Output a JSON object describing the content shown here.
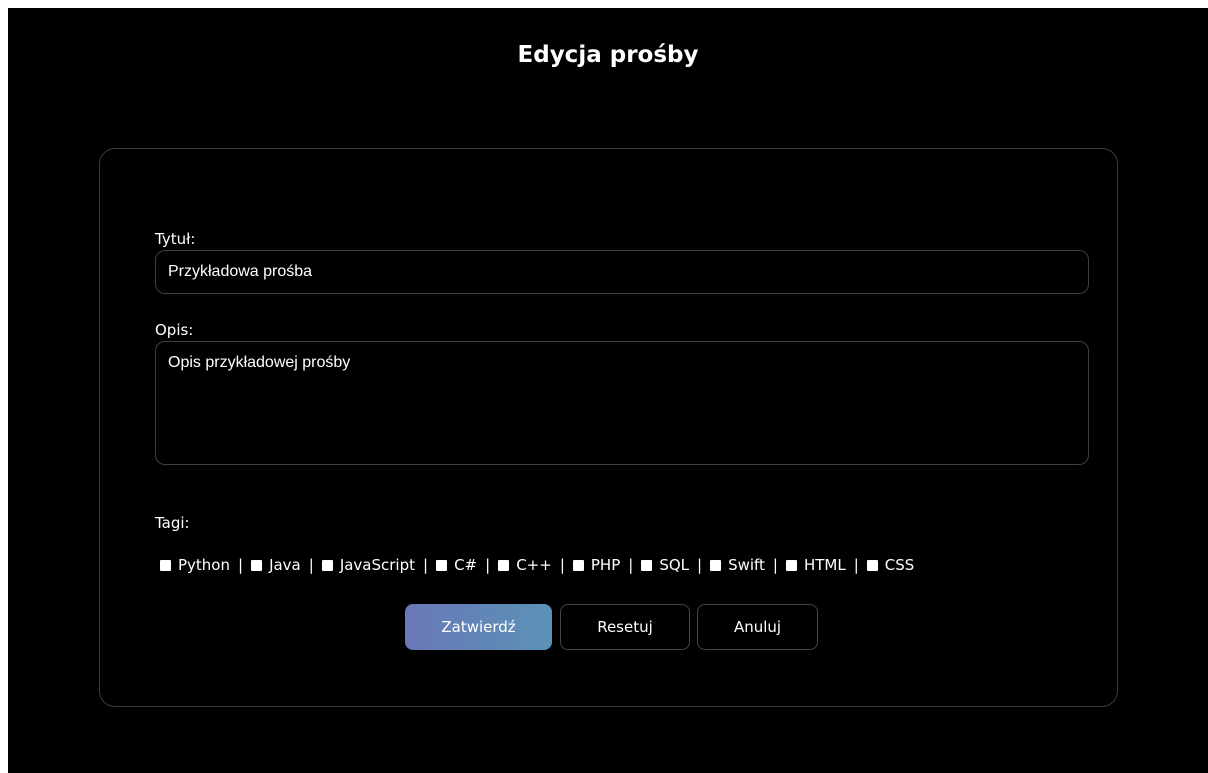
{
  "header": {
    "title": "Edycja prośby"
  },
  "form": {
    "title_label": "Tytuł:",
    "title_value": "Przykładowa prośba",
    "description_label": "Opis:",
    "description_value": "Opis przykładowej prośby",
    "tags_label": "Tagi:",
    "tags": [
      {
        "label": "Python",
        "checked": false
      },
      {
        "label": "Java",
        "checked": false
      },
      {
        "label": "JavaScript",
        "checked": false
      },
      {
        "label": "C#",
        "checked": false
      },
      {
        "label": "C++",
        "checked": false
      },
      {
        "label": "PHP",
        "checked": false
      },
      {
        "label": "SQL",
        "checked": false
      },
      {
        "label": "Swift",
        "checked": false
      },
      {
        "label": "HTML",
        "checked": false
      },
      {
        "label": "CSS",
        "checked": false
      }
    ],
    "separator": "|"
  },
  "buttons": {
    "submit_label": "Zatwierdź",
    "reset_label": "Resetuj",
    "cancel_label": "Anuluj"
  },
  "colors": {
    "background": "#000000",
    "card_border": "#3c3c3c",
    "submit_gradient_start": "#6a77b8",
    "submit_gradient_end": "#5a93b6"
  }
}
